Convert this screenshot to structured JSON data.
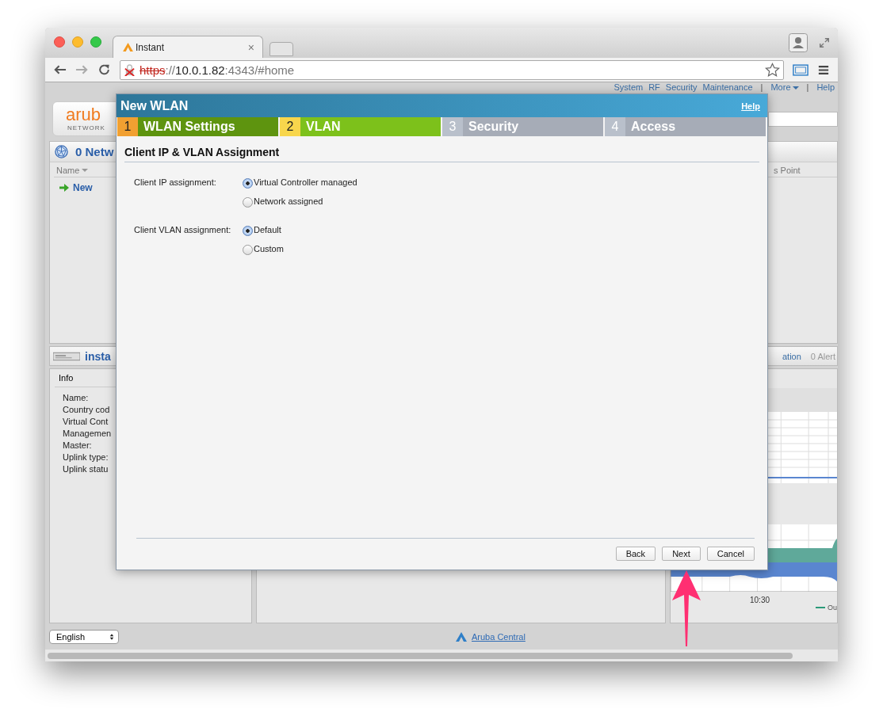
{
  "browser": {
    "tab_title": "Instant",
    "tab_close": "×",
    "url_scheme": "https",
    "url_sep": "://",
    "url_host": "10.0.1.82",
    "url_rest": ":4343/#home"
  },
  "top_nav": [
    {
      "kind": "link",
      "label": "System"
    },
    {
      "kind": "link",
      "label": "RF"
    },
    {
      "kind": "link",
      "label": "Security"
    },
    {
      "kind": "link",
      "label": "Maintenance"
    },
    {
      "kind": "separator",
      "label": "|"
    },
    {
      "kind": "menu",
      "label": "More"
    },
    {
      "kind": "separator",
      "label": "|"
    },
    {
      "kind": "link",
      "label": "Help"
    }
  ],
  "logo": {
    "name": "arub",
    "tagline": "NETWORK"
  },
  "networks_panel": {
    "title": "0 Netw",
    "column": "Name",
    "rows": [
      {
        "label": "New"
      }
    ]
  },
  "access_points_panel": {
    "column": "s Point"
  },
  "instant_bar": {
    "title": "insta",
    "tab": "ation",
    "alerts": "0 Alert"
  },
  "info_panel": {
    "title": "Info",
    "fields": [
      "Name:",
      "Country cod",
      "Virtual Cont",
      "Managemen",
      "Master:",
      "Uplink type:",
      "Uplink statu"
    ]
  },
  "chart_panel": {
    "x_tick": "10:30",
    "legend": "Ou"
  },
  "footer": {
    "language": "English",
    "link": "Aruba Central"
  },
  "dialog": {
    "title": "New WLAN",
    "help": "Help",
    "steps": [
      {
        "number": "1",
        "label": "WLAN Settings",
        "completed": true,
        "selected": false
      },
      {
        "number": "2",
        "label": "VLAN",
        "completed": false,
        "selected": true
      },
      {
        "number": "3",
        "label": "Security",
        "completed": false,
        "selected": false
      },
      {
        "number": "4",
        "label": "Access",
        "completed": false,
        "selected": false
      }
    ],
    "heading": "Client IP & VLAN Assignment",
    "groups": [
      {
        "label": "Client IP assignment:",
        "options": [
          {
            "label": "Virtual Controller managed",
            "selected": true
          },
          {
            "label": "Network assigned",
            "selected": false
          }
        ]
      },
      {
        "label": "Client VLAN assignment:",
        "options": [
          {
            "label": "Default",
            "selected": true
          },
          {
            "label": "Custom",
            "selected": false
          }
        ]
      }
    ],
    "buttons": [
      "Back",
      "Next",
      "Cancel"
    ]
  }
}
